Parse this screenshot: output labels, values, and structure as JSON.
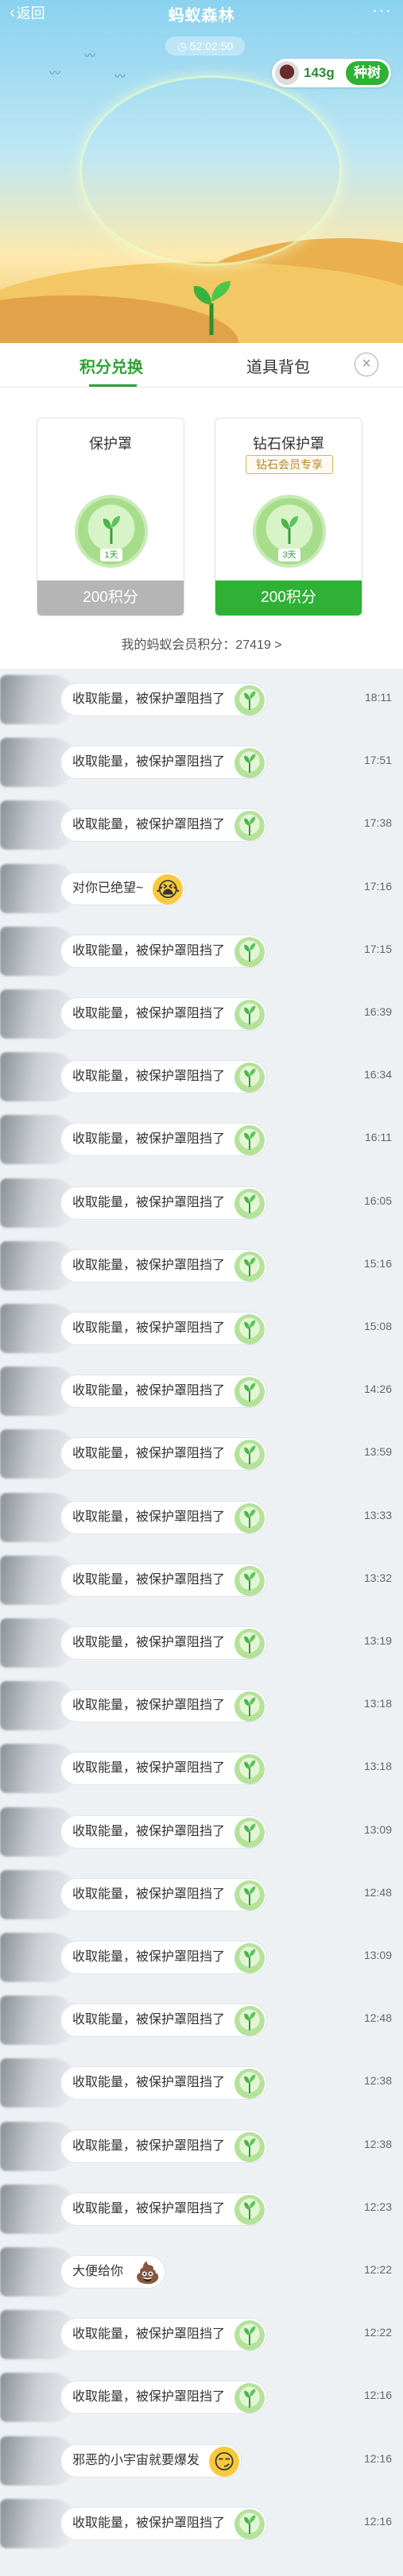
{
  "header": {
    "back_label": "返回",
    "title": "蚂蚁森林",
    "more_label": "···",
    "timer": "52:02:50",
    "energy": "143g",
    "plant_button": "种树"
  },
  "tabs": {
    "points_exchange": "积分兑换",
    "props_bag": "道具背包",
    "close": "×"
  },
  "cards": [
    {
      "name": "保护罩",
      "vip_tag": "",
      "days": "1天",
      "price": "200积分",
      "price_style": "gray"
    },
    {
      "name": "钻石保护罩",
      "vip_tag": "钻石会员专享",
      "days": "3天",
      "price": "200积分",
      "price_style": "green"
    }
  ],
  "member_points": "我的蚂蚁会员积分：27419 >",
  "feed": [
    {
      "text": "收取能量，被保护罩阻挡了",
      "icon": "shield-icon",
      "time": "18:11"
    },
    {
      "text": "收取能量，被保护罩阻挡了",
      "icon": "shield-icon",
      "time": "17:51"
    },
    {
      "text": "收取能量，被保护罩阻挡了",
      "icon": "shield-icon",
      "time": "17:38"
    },
    {
      "text": "对你已绝望~",
      "icon": "crying-emoji-icon",
      "time": "17:16"
    },
    {
      "text": "收取能量，被保护罩阻挡了",
      "icon": "shield-icon",
      "time": "17:15"
    },
    {
      "text": "收取能量，被保护罩阻挡了",
      "icon": "shield-icon",
      "time": "16:39"
    },
    {
      "text": "收取能量，被保护罩阻挡了",
      "icon": "shield-icon",
      "time": "16:34"
    },
    {
      "text": "收取能量，被保护罩阻挡了",
      "icon": "shield-icon",
      "time": "16:11"
    },
    {
      "text": "收取能量，被保护罩阻挡了",
      "icon": "shield-icon",
      "time": "16:05"
    },
    {
      "text": "收取能量，被保护罩阻挡了",
      "icon": "shield-icon",
      "time": "15:16"
    },
    {
      "text": "收取能量，被保护罩阻挡了",
      "icon": "shield-icon",
      "time": "15:08"
    },
    {
      "text": "收取能量，被保护罩阻挡了",
      "icon": "shield-icon",
      "time": "14:26"
    },
    {
      "text": "收取能量，被保护罩阻挡了",
      "icon": "shield-icon",
      "time": "13:59"
    },
    {
      "text": "收取能量，被保护罩阻挡了",
      "icon": "shield-icon",
      "time": "13:33"
    },
    {
      "text": "收取能量，被保护罩阻挡了",
      "icon": "shield-icon",
      "time": "13:32"
    },
    {
      "text": "收取能量，被保护罩阻挡了",
      "icon": "shield-icon",
      "time": "13:19"
    },
    {
      "text": "收取能量，被保护罩阻挡了",
      "icon": "shield-icon",
      "time": "13:18"
    },
    {
      "text": "收取能量，被保护罩阻挡了",
      "icon": "shield-icon",
      "time": "13:18"
    },
    {
      "text": "收取能量，被保护罩阻挡了",
      "icon": "shield-icon",
      "time": "13:09"
    },
    {
      "text": "收取能量，被保护罩阻挡了",
      "icon": "shield-icon",
      "time": "12:48"
    },
    {
      "text": "收取能量，被保护罩阻挡了",
      "icon": "shield-icon",
      "time": "13:09"
    },
    {
      "text": "收取能量，被保护罩阻挡了",
      "icon": "shield-icon",
      "time": "12:48"
    },
    {
      "text": "收取能量，被保护罩阻挡了",
      "icon": "shield-icon",
      "time": "12:38"
    },
    {
      "text": "收取能量，被保护罩阻挡了",
      "icon": "shield-icon",
      "time": "12:38"
    },
    {
      "text": "收取能量，被保护罩阻挡了",
      "icon": "shield-icon",
      "time": "12:23"
    },
    {
      "text": "大便给你",
      "icon": "poop-emoji-icon",
      "time": "12:22"
    },
    {
      "text": "收取能量，被保护罩阻挡了",
      "icon": "shield-icon",
      "time": "12:22"
    },
    {
      "text": "收取能量，被保护罩阻挡了",
      "icon": "shield-icon",
      "time": "12:16"
    },
    {
      "text": "邪恶的小宇宙就要爆发",
      "icon": "grin-emoji-icon",
      "time": "12:16"
    },
    {
      "text": "收取能量，被保护罩阻挡了",
      "icon": "shield-icon",
      "time": "12:16"
    }
  ]
}
